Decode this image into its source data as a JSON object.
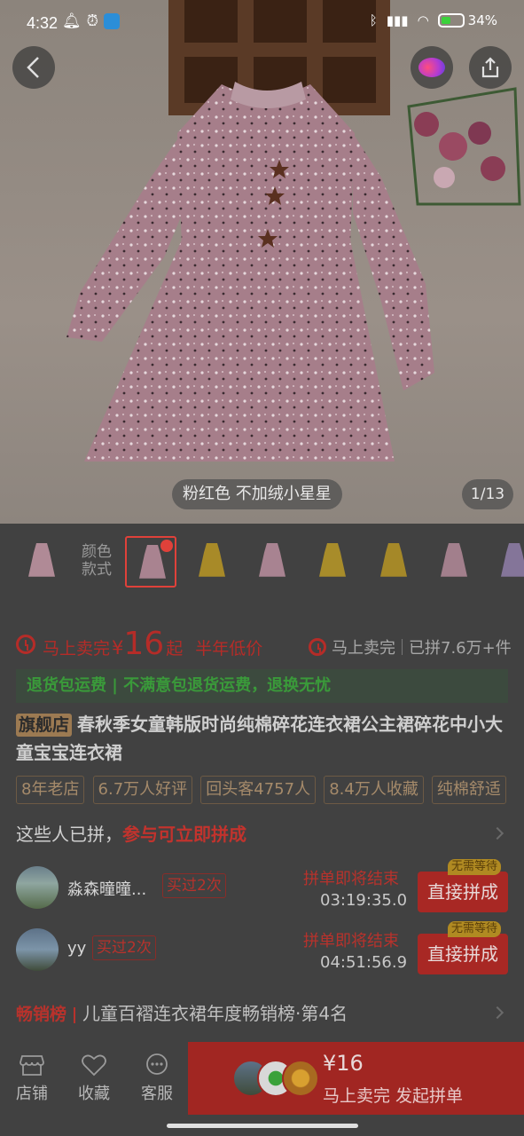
{
  "status_bar": {
    "time": "4:32",
    "battery": "34%"
  },
  "hero": {
    "variant_caption": "粉红色 不加绒小星星",
    "image_counter": "1/13"
  },
  "variants": {
    "label_line1": "颜色",
    "label_line2": "款式",
    "items": [
      {
        "color": "#d9a7b9"
      },
      {
        "color": "#d9a7b9",
        "selected": true
      },
      {
        "color": "#d9b22a"
      },
      {
        "color": "#d8a4b6"
      },
      {
        "color": "#d6b030"
      },
      {
        "color": "#d3ac2a"
      },
      {
        "color": "#cf9fb1"
      },
      {
        "color": "#a493c8"
      }
    ]
  },
  "promo": {
    "sell_fast": "马上卖完",
    "currency": "¥",
    "price": "16",
    "from_suffix": "起",
    "low_price_tag": "半年低价",
    "right_sell_fast": "马上卖完",
    "joined_count": "已拼7.6万+件"
  },
  "refund": {
    "text": "退货包运费 | 不满意包退货运费，退换无忧"
  },
  "product": {
    "store_badge": "旗舰店",
    "title": "春秋季女童韩版时尚纯棉碎花连衣裙公主裙碎花中小大童宝宝连衣裙"
  },
  "tags": [
    "8年老店",
    "6.7万人好评",
    "回头客4757人",
    "8.4万人收藏",
    "纯棉舒适"
  ],
  "group_buy": {
    "heading": "这些人已拼，",
    "heading_accent": "参与可立即拼成",
    "no_wait": "无需等待",
    "ending_soon": "拼单即将结束",
    "join_label": "直接拼成",
    "rows": [
      {
        "name": "淼森曈曈...",
        "bought": "买过2次",
        "countdown": "03:19:35.0"
      },
      {
        "name": "yy",
        "bought": "买过2次",
        "countdown": "04:51:56.9"
      }
    ]
  },
  "ranking": {
    "badge": "畅销榜",
    "text": "儿童百褶连衣裙年度畅销榜·第4名"
  },
  "bottom_bar": {
    "store": "店铺",
    "favorite": "收藏",
    "service": "客服",
    "buy_price": "¥16",
    "buy_label": "马上卖完 发起拼单"
  },
  "colors": {
    "accent_red": "#a12622",
    "green": "#3a9a3a",
    "gold": "#9c7a52"
  }
}
